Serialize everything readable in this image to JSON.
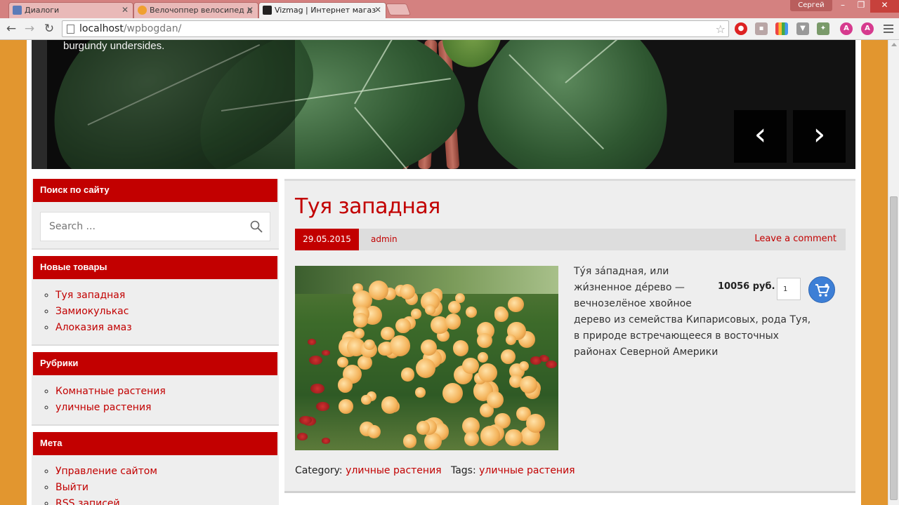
{
  "browser": {
    "tabs": [
      {
        "title": "Диалоги",
        "icon_color": "#5b7bb8"
      },
      {
        "title": "Велочоппер велосипед д",
        "icon_color": "#f0a030"
      },
      {
        "title": "Vizmag | Интернет магаз",
        "icon_color": "#222222"
      }
    ],
    "user": "Сергей",
    "url_host": "localhost",
    "url_path": "/wpbogdan/"
  },
  "slider": {
    "caption": "burgundy undersides.",
    "prev_label": "‹",
    "next_label": "›"
  },
  "sidebar": {
    "search": {
      "title": "Поиск по сайту",
      "placeholder": "Search ..."
    },
    "new_products": {
      "title": "Новые товары",
      "items": [
        "Туя западная",
        "Замиокулькас",
        "Алоказия амаз"
      ]
    },
    "categories": {
      "title": "Рубрики",
      "items": [
        "Комнатные растения",
        "уличные растения"
      ]
    },
    "meta": {
      "title": "Мета",
      "items": [
        "Управление сайтом",
        "Выйти",
        "RSS записей"
      ]
    }
  },
  "post": {
    "title": "Туя западная",
    "date": "29.05.2015",
    "author": "admin",
    "comment_link": "Leave a comment",
    "text_top": "Ту́я за́падная, или жи́зненное де́рево — вечнозелёное хвойное",
    "text_rest": "дерево из семейства Кипарисовых, рода Туя, в природе встречающееся в восточных районах Северной Америки",
    "price": "10056 руб.",
    "quantity": "1",
    "category_label": "Category:",
    "category_value": "уличные растения",
    "tags_label": "Tags:",
    "tags_value": "уличные растения"
  },
  "colors": {
    "accent": "#c20000",
    "background": "#e2962f",
    "cart": "#3d7fd6"
  }
}
